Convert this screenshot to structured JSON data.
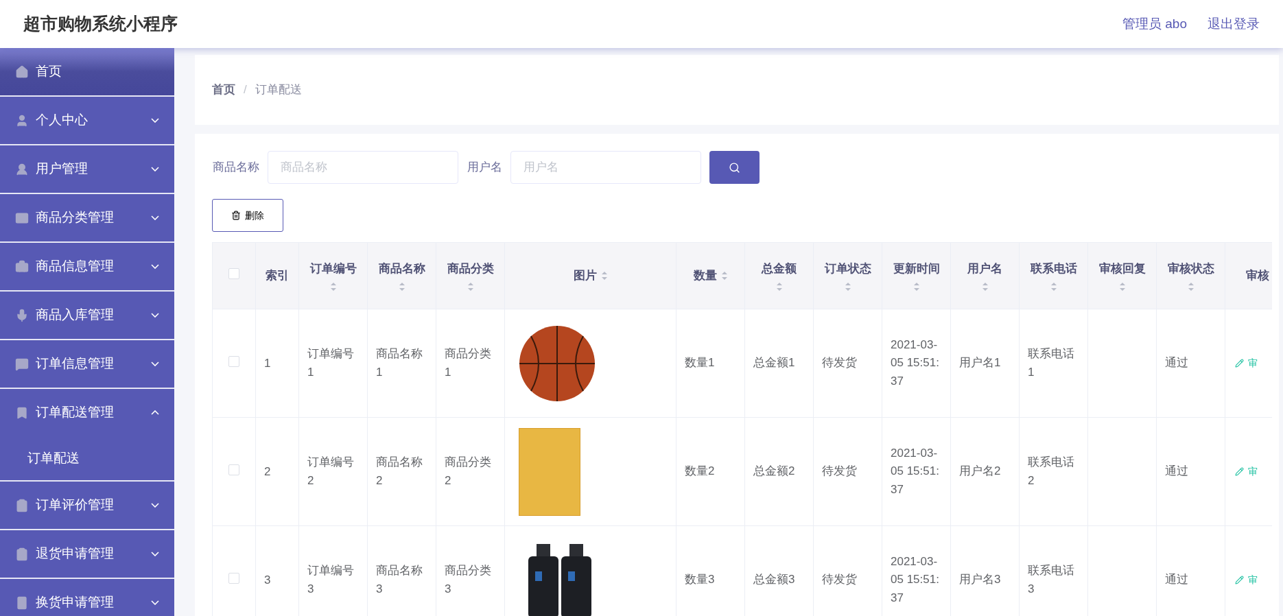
{
  "header": {
    "title": "超市购物系统小程序",
    "user": "管理员 abo",
    "logout": "退出登录"
  },
  "sidebar": {
    "items": [
      {
        "label": "首页",
        "selected": true
      },
      {
        "label": "个人中心",
        "expanded": false,
        "selected": false
      },
      {
        "label": "用户管理",
        "expanded": false,
        "selected": false
      },
      {
        "label": "商品分类管理",
        "expanded": false,
        "selected": false
      },
      {
        "label": "商品信息管理",
        "expanded": false,
        "selected": false
      },
      {
        "label": "商品入库管理",
        "expanded": false,
        "selected": false
      },
      {
        "label": "订单信息管理",
        "expanded": false,
        "selected": false
      },
      {
        "label": "订单配送管理",
        "expanded": true,
        "selected": false,
        "children": [
          {
            "label": "订单配送",
            "selected": false
          }
        ]
      },
      {
        "label": "订单评价管理",
        "expanded": false,
        "selected": false
      },
      {
        "label": "退货申请管理",
        "expanded": false,
        "selected": false
      },
      {
        "label": "换货申请管理",
        "expanded": false,
        "selected": false
      }
    ]
  },
  "breadcrumb": {
    "items": [
      "首页",
      "订单配送"
    ],
    "separator": "/"
  },
  "search": {
    "fields": [
      {
        "label": "商品名称",
        "placeholder": "商品名称"
      },
      {
        "label": "用户名",
        "placeholder": "用户名"
      }
    ]
  },
  "delete_button": "删除",
  "table": {
    "select_all": {
      "checked": false
    },
    "columns": [
      {
        "label": "索引",
        "sortable": false
      },
      {
        "label": "订单编号",
        "sortable": true
      },
      {
        "label": "商品名称",
        "sortable": true
      },
      {
        "label": "商品分类",
        "sortable": true
      },
      {
        "label": "图片",
        "sortable": true
      },
      {
        "label": "数量",
        "sortable": true
      },
      {
        "label": "总金额",
        "sortable": true
      },
      {
        "label": "订单状态",
        "sortable": true
      },
      {
        "label": "更新时间",
        "sortable": true
      },
      {
        "label": "用户名",
        "sortable": true
      },
      {
        "label": "联系电话",
        "sortable": true
      },
      {
        "label": "审核回复",
        "sortable": true
      },
      {
        "label": "审核状态",
        "sortable": true
      },
      {
        "label": "审核",
        "sortable": false
      }
    ],
    "rows": [
      {
        "checked": false,
        "index": "1",
        "order_no": "订单编号1",
        "product": "商品名称1",
        "category": "商品分类1",
        "kind": "ball",
        "qty": "数量1",
        "total": "总金额1",
        "status": "待发货",
        "updated": "2021-03-05 15:51:37",
        "username": "用户名1",
        "phone": "联系电话1",
        "review_status": "通过",
        "action": "审"
      },
      {
        "checked": false,
        "index": "2",
        "order_no": "订单编号2",
        "product": "商品名称2",
        "category": "商品分类2",
        "kind": "book",
        "qty": "数量2",
        "total": "总金额2",
        "status": "待发货",
        "updated": "2021-03-05 15:51:37",
        "username": "用户名2",
        "phone": "联系电话2",
        "review_status": "通过",
        "action": "审"
      },
      {
        "checked": false,
        "index": "3",
        "order_no": "订单编号3",
        "product": "商品名称3",
        "category": "商品分类3",
        "kind": "bottles",
        "qty": "数量3",
        "total": "总金额3",
        "status": "待发货",
        "updated": "2021-03-05 15:51:37",
        "username": "用户名3",
        "phone": "联系电话3",
        "review_status": "通过",
        "action": "审"
      }
    ]
  }
}
